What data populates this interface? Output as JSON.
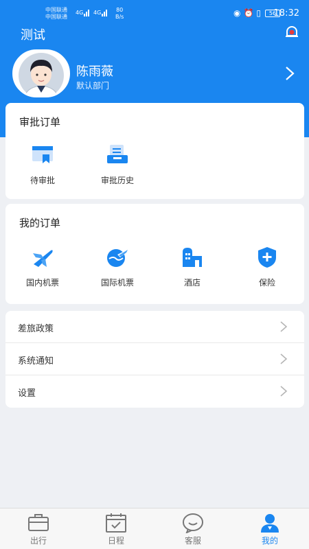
{
  "status_bar": {
    "carrier1": "中国联通",
    "carrier2": "中国联通",
    "signal1": "4G",
    "signal2": "4G",
    "net_speed_value": "80",
    "net_speed_unit": "B/s",
    "battery": "56",
    "time": "18:32"
  },
  "header": {
    "title": "测试"
  },
  "profile": {
    "name": "陈雨薇",
    "department": "默认部门"
  },
  "approval_card": {
    "title": "审批订单",
    "items": [
      {
        "label": "待审批",
        "icon": "pending-approval-icon"
      },
      {
        "label": "审批历史",
        "icon": "approval-history-icon"
      }
    ]
  },
  "orders_card": {
    "title": "我的订单",
    "items": [
      {
        "label": "国内机票",
        "icon": "plane-icon"
      },
      {
        "label": "国际机票",
        "icon": "globe-plane-icon"
      },
      {
        "label": "酒店",
        "icon": "hotel-icon"
      },
      {
        "label": "保险",
        "icon": "shield-plus-icon"
      }
    ]
  },
  "menu": [
    {
      "label": "差旅政策"
    },
    {
      "label": "系统通知"
    },
    {
      "label": "设置"
    }
  ],
  "tabbar": {
    "items": [
      {
        "label": "出行",
        "icon": "briefcase-icon"
      },
      {
        "label": "日程",
        "icon": "calendar-icon"
      },
      {
        "label": "客服",
        "icon": "chat-icon"
      },
      {
        "label": "我的",
        "icon": "person-icon",
        "active": true
      }
    ]
  },
  "colors": {
    "primary": "#1a86f0",
    "background": "#eef0f4",
    "tab_inactive": "#777777"
  }
}
